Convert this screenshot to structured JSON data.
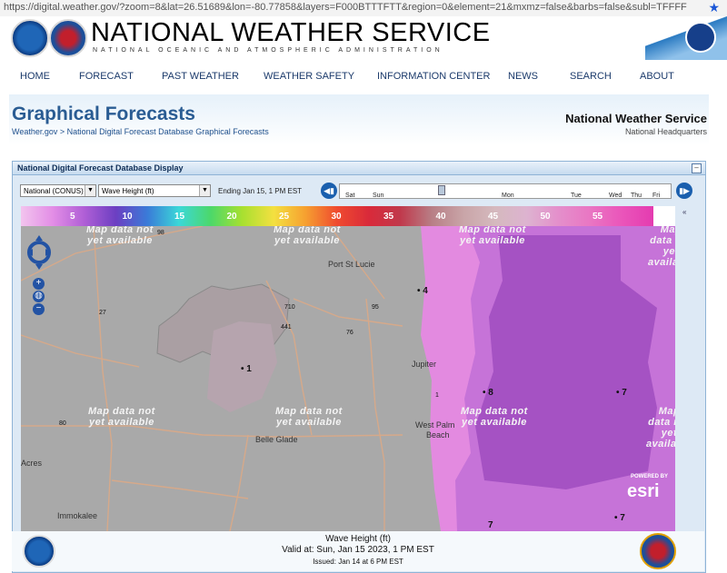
{
  "browser": {
    "url": "https://digital.weather.gov/?zoom=8&lat=26.51689&lon=-80.77858&layers=F000BTTTFTT&region=0&element=21&mxmz=false&barbs=false&subl=TFFFF"
  },
  "header": {
    "title": "NATIONAL WEATHER SERVICE",
    "subtitle": "NATIONAL OCEANIC AND ATMOSPHERIC ADMINISTRATION"
  },
  "nav": [
    "HOME",
    "FORECAST",
    "PAST WEATHER",
    "WEATHER SAFETY",
    "INFORMATION CENTER",
    "NEWS",
    "SEARCH",
    "ABOUT"
  ],
  "page": {
    "title": "Graphical Forecasts",
    "breadcrumb_home": "Weather.gov",
    "breadcrumb_sep": " > ",
    "breadcrumb_current": "National Digital Forecast Database Graphical Forecasts",
    "office": "National Weather Service",
    "office_sub": "National Headquarters"
  },
  "panel": {
    "title": "National Digital Forecast Database Display",
    "region_select": "National (CONUS)",
    "element_select": "Wave Height (ft)",
    "ending": "Ending Jan 15,   1 PM EST",
    "timeline_days": [
      "Sat",
      "Sun",
      "Mon",
      "Tue",
      "Wed",
      "Thu",
      "Fri"
    ]
  },
  "legend": {
    "labels": [
      "5",
      "10",
      "15",
      "20",
      "25",
      "30",
      "35",
      "40",
      "45",
      "50",
      "55"
    ],
    "colors": [
      "#f2c4ee",
      "#e38ee6",
      "#b05fd6",
      "#6c3fc2",
      "#3a7bd8",
      "#3bd8d8",
      "#4cd86a",
      "#a8e030",
      "#f4e040",
      "#f6a030",
      "#ef4a2f",
      "#d92a3a",
      "#c0394c",
      "#b87f86",
      "#c9a5a8",
      "#d5b9be",
      "#ddb3d0",
      "#e48fcb",
      "#e976c3",
      "#ea55ba",
      "#e43bb0"
    ]
  },
  "map": {
    "unavailable_text_1": "Map data not",
    "unavailable_text_2": "yet available",
    "cities": [
      "Port St Lucie",
      "Jupiter",
      "West Palm",
      "Beach",
      "Belle Glade",
      "Immokalee",
      "Acres"
    ],
    "points": [
      "1",
      "4",
      "8",
      "7",
      "7",
      "7"
    ],
    "roads": [
      "98",
      "710",
      "441",
      "76",
      "27",
      "80",
      "95",
      "1"
    ],
    "attribution_top": "POWERED BY",
    "attribution": "esri",
    "colors": {
      "land": "#a9a9a9",
      "lake": "#b6a4ae",
      "water_light": "#e38ae0",
      "water_mid": "#c673d8",
      "water_deep": "#a552c3",
      "roads": "#d6a98a"
    }
  },
  "footer": {
    "element": "Wave Height (ft)",
    "valid": "Valid at:  Sun, Jan 15 2023,     1 PM EST",
    "issued": "Issued: Jan 14 at 6 PM EST"
  }
}
